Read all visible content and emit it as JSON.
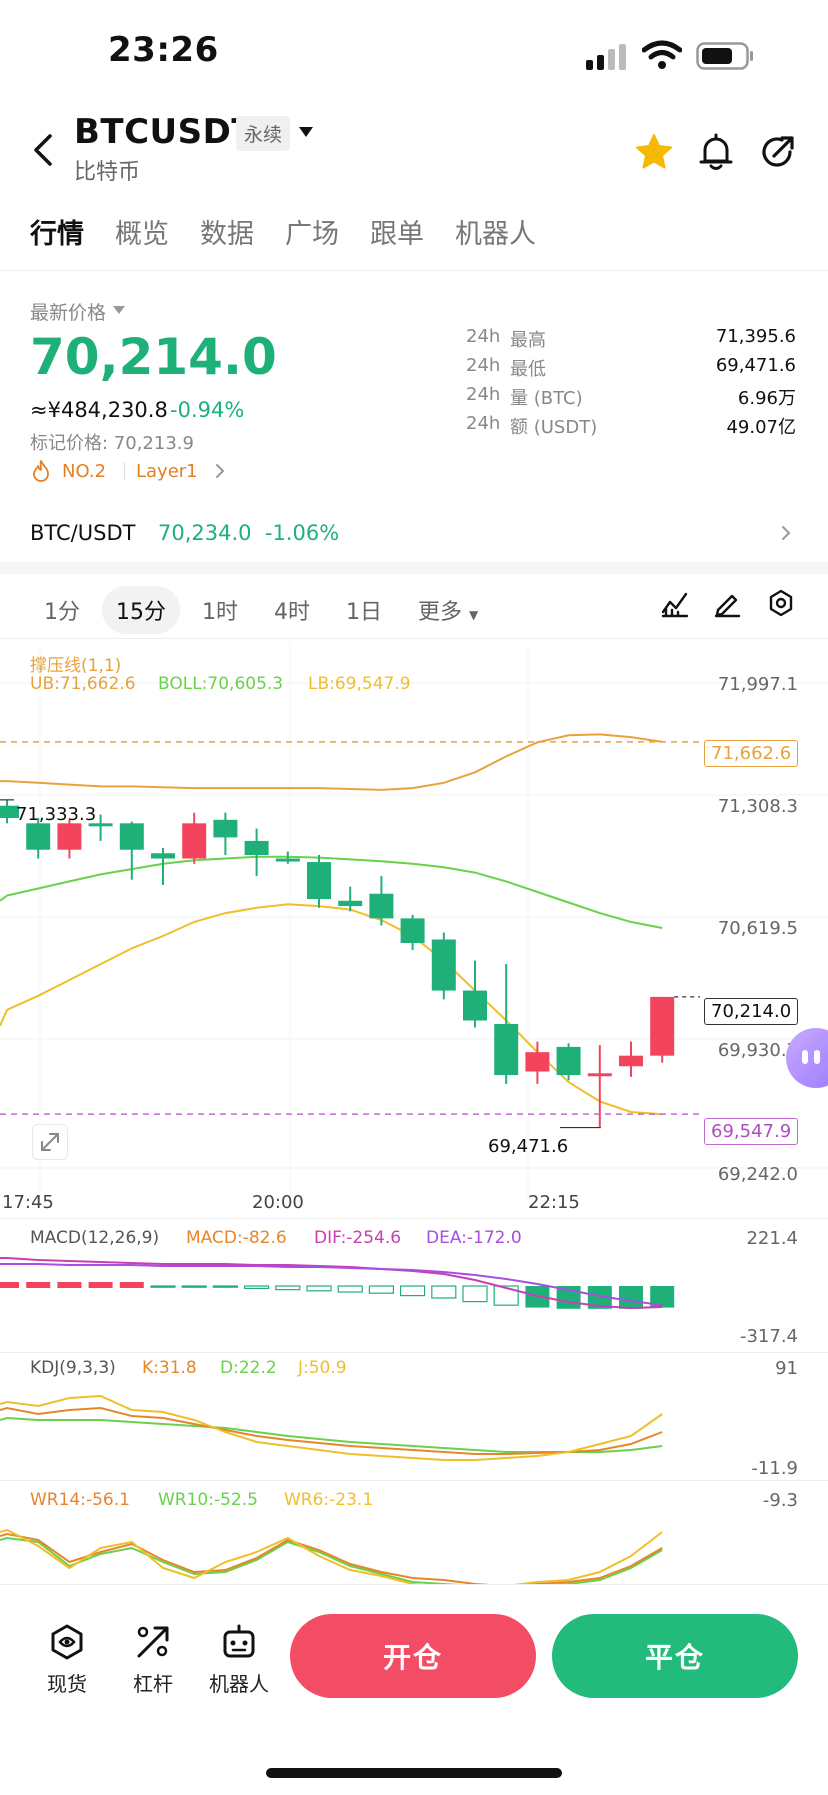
{
  "status": {
    "time": "23:26"
  },
  "header": {
    "symbol": "BTCUSDT",
    "badge": "永续",
    "subtitle": "比特币"
  },
  "tabs": [
    "行情",
    "概览",
    "数据",
    "广场",
    "跟单",
    "机器人"
  ],
  "price": {
    "label": "最新价格",
    "last": "70,214.0",
    "cny": "≈¥484,230.8",
    "change": "-0.94%",
    "mark": "标记价格: 70,213.9",
    "rank": "NO.2",
    "tag": "Layer1"
  },
  "stats": [
    {
      "period": "24h",
      "name": "最高",
      "value": "71,395.6"
    },
    {
      "period": "24h",
      "name": "最低",
      "value": "69,471.6"
    },
    {
      "period": "24h",
      "name": "量 (BTC)",
      "value": "6.96万"
    },
    {
      "period": "24h",
      "name": "额 (USDT)",
      "value": "49.07亿"
    }
  ],
  "spot": {
    "pair": "BTC/USDT",
    "price": "70,234.0",
    "change": "-1.06%"
  },
  "timeframes": [
    "1分",
    "15分",
    "1时",
    "4时",
    "1日",
    "更多"
  ],
  "colors": {
    "up": "#1fb07a",
    "down": "#f2445c",
    "ub": "#e9a23b",
    "boll": "#6ad14a",
    "lb": "#f0bf28",
    "macd": "#e6862b",
    "dif": "#c83fb5",
    "dea": "#a84ee0"
  },
  "main_chart": {
    "indicator": "撑压线(1,1)",
    "ub_label": "UB:71,662.6",
    "boll_label": "BOLL:70,605.3",
    "lb_label": "LB:69,547.9",
    "y_ticks": [
      "71,997.1",
      "71,308.3",
      "70,619.5",
      "69,930.7",
      "69,242.0"
    ],
    "ub_tag": "71,662.6",
    "last_tag": "70,214.0",
    "lb_tag": "69,547.9",
    "high_mark": "71,333.3",
    "low_mark": "69,471.6",
    "x_ticks": [
      "17:45",
      "20:00",
      "22:15"
    ]
  },
  "chart_data": {
    "type": "candlestick",
    "y_range": [
      69242.0,
      71997.1
    ],
    "candles": [
      {
        "o": 71300,
        "h": 71333,
        "l": 71200,
        "c": 71230
      },
      {
        "o": 71200,
        "h": 71230,
        "l": 71000,
        "c": 71050
      },
      {
        "o": 71050,
        "h": 71220,
        "l": 71000,
        "c": 71200
      },
      {
        "o": 71200,
        "h": 71250,
        "l": 71100,
        "c": 71190
      },
      {
        "o": 71200,
        "h": 71210,
        "l": 70880,
        "c": 71050
      },
      {
        "o": 71030,
        "h": 71060,
        "l": 70850,
        "c": 71000
      },
      {
        "o": 71000,
        "h": 71260,
        "l": 70970,
        "c": 71200
      },
      {
        "o": 71220,
        "h": 71260,
        "l": 71020,
        "c": 71120
      },
      {
        "o": 71100,
        "h": 71170,
        "l": 70900,
        "c": 71020
      },
      {
        "o": 71000,
        "h": 71040,
        "l": 70970,
        "c": 70990
      },
      {
        "o": 70980,
        "h": 71020,
        "l": 70720,
        "c": 70770
      },
      {
        "o": 70760,
        "h": 70840,
        "l": 70700,
        "c": 70730
      },
      {
        "o": 70800,
        "h": 70900,
        "l": 70620,
        "c": 70660
      },
      {
        "o": 70660,
        "h": 70680,
        "l": 70480,
        "c": 70520
      },
      {
        "o": 70540,
        "h": 70580,
        "l": 70200,
        "c": 70250
      },
      {
        "o": 70250,
        "h": 70420,
        "l": 70040,
        "c": 70080
      },
      {
        "o": 70060,
        "h": 70400,
        "l": 69720,
        "c": 69770
      },
      {
        "o": 69790,
        "h": 69960,
        "l": 69720,
        "c": 69900
      },
      {
        "o": 69930,
        "h": 69950,
        "l": 69740,
        "c": 69770
      },
      {
        "o": 69770,
        "h": 69940,
        "l": 69471.6,
        "c": 69780
      },
      {
        "o": 69820,
        "h": 69960,
        "l": 69760,
        "c": 69880
      },
      {
        "o": 69880,
        "h": 70214,
        "l": 69840,
        "c": 70214
      }
    ],
    "ub": [
      71440,
      71430,
      71420,
      71410,
      71410,
      71405,
      71400,
      71400,
      71400,
      71400,
      71400,
      71395,
      71390,
      71400,
      71430,
      71490,
      71580,
      71660,
      71700,
      71705,
      71690,
      71662.6
    ],
    "boll": [
      70790,
      70830,
      70870,
      70910,
      70940,
      70970,
      70990,
      71000,
      71010,
      71010,
      71005,
      70995,
      70985,
      70970,
      70950,
      70920,
      70870,
      70810,
      70750,
      70690,
      70640,
      70605.3
    ],
    "lb": [
      70140,
      70220,
      70310,
      70400,
      70490,
      70560,
      70640,
      70690,
      70720,
      70740,
      70730,
      70710,
      70650,
      70560,
      70420,
      70250,
      70080,
      69900,
      69730,
      69620,
      69560,
      69547.9
    ]
  },
  "macd": {
    "label": "MACD(12,26,9)",
    "macd": "MACD:-82.6",
    "dif": "DIF:-254.6",
    "dea": "DEA:-172.0",
    "y_top": "221.4",
    "y_bottom": "-317.4"
  },
  "kdj": {
    "label": "KDJ(9,3,3)",
    "k": "K:31.8",
    "d": "D:22.2",
    "j": "J:50.9",
    "y_top": "91",
    "y_bottom": "-11.9"
  },
  "wr": {
    "wr14": "WR14:-56.1",
    "wr10": "WR10:-52.5",
    "wr6": "WR6:-23.1",
    "y_top": "-9.3"
  },
  "bottom": {
    "spot": "现货",
    "leverage": "杠杆",
    "bot": "机器人",
    "open": "开仓",
    "close": "平仓"
  }
}
